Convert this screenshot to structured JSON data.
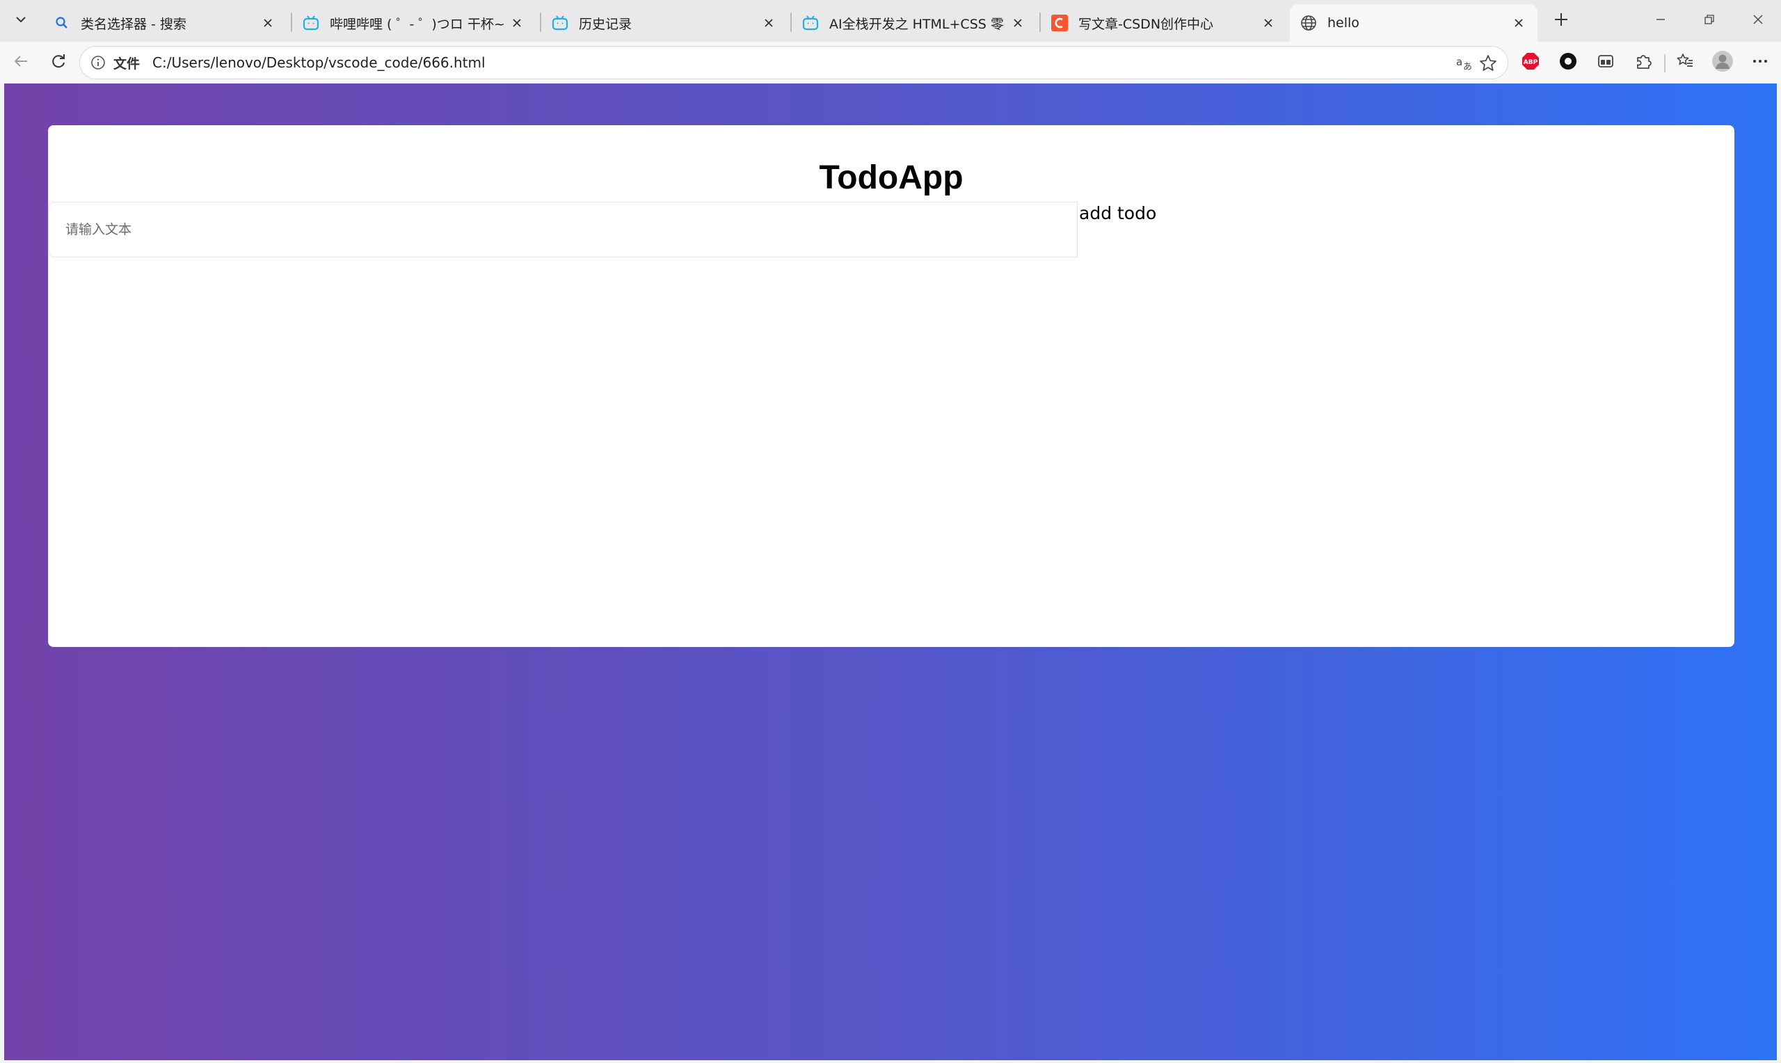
{
  "browser": {
    "tabs": [
      {
        "title": "类名选择器 - 搜索",
        "icon": "search-icon"
      },
      {
        "title": "哔哩哔哩 ( ゜- ゜)つロ 干杯~-bilibili",
        "icon": "bilibili-icon"
      },
      {
        "title": "历史记录",
        "icon": "bilibili-icon"
      },
      {
        "title": "AI全栈开发之 HTML+CSS 零基础入门",
        "icon": "bilibili-icon"
      },
      {
        "title": "写文章-CSDN创作中心",
        "icon": "csdn-icon"
      },
      {
        "title": "hello",
        "icon": "globe-icon"
      }
    ],
    "address": {
      "scheme_label": "文件",
      "url": "C:/Users/lenovo/Desktop/vscode_code/666.html"
    },
    "extensions": {
      "adblock_label": "ABP"
    }
  },
  "page": {
    "title": "TodoApp",
    "input_placeholder": "请输入文本",
    "add_button_label": "add todo"
  },
  "colors": {
    "gradient_start": "#7343a9",
    "gradient_end": "#2e72f6",
    "csdn_red": "#fc5531",
    "bilibili_blue": "#23ade5",
    "abp_red": "#e3102f"
  }
}
